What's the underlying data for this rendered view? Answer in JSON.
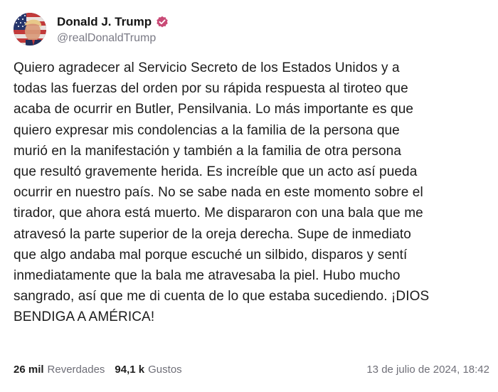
{
  "author": {
    "display_name": "Donald J. Trump",
    "handle": "@realDonaldTrump",
    "verified_icon": "verified-badge-icon",
    "avatar_icon": "profile-avatar"
  },
  "post": {
    "text": "Quiero agradecer al Servicio Secreto de los Estados Unidos y a\ntodas las fuerzas del orden por su rápida respuesta al tiroteo que\nacaba de ocurrir en Butler, Pensilvania. Lo más importante es que\nquiero expresar mis condolencias a la familia de la persona que\nmurió en la manifestación y también a la familia de otra persona\nque resultó gravemente herida. Es increíble que un acto así pueda\nocurrir en nuestro país. No se sabe nada en este momento sobre el\ntirador, que ahora está muerto. Me dispararon con una bala que me\natravesó la parte superior de la oreja derecha. Supe de inmediato\nque algo andaba mal porque escuché un silbido, disparos y sentí\ninmediatamente que la bala me atravesaba la piel. Hubo mucho\nsangrado, así que me di cuenta de lo que estaba sucediendo. ¡DIOS\nBENDIGA A AMÉRICA!"
  },
  "stats": {
    "reposts_count": "26 mil",
    "reposts_label": "Reverdades",
    "likes_count": "94,1 k",
    "likes_label": "Gustos"
  },
  "timestamp": "13 de julio de 2024, 18:42",
  "colors": {
    "verified": "#c94a76",
    "muted_text": "#6f6f78",
    "body_text": "#1c1c1c"
  }
}
